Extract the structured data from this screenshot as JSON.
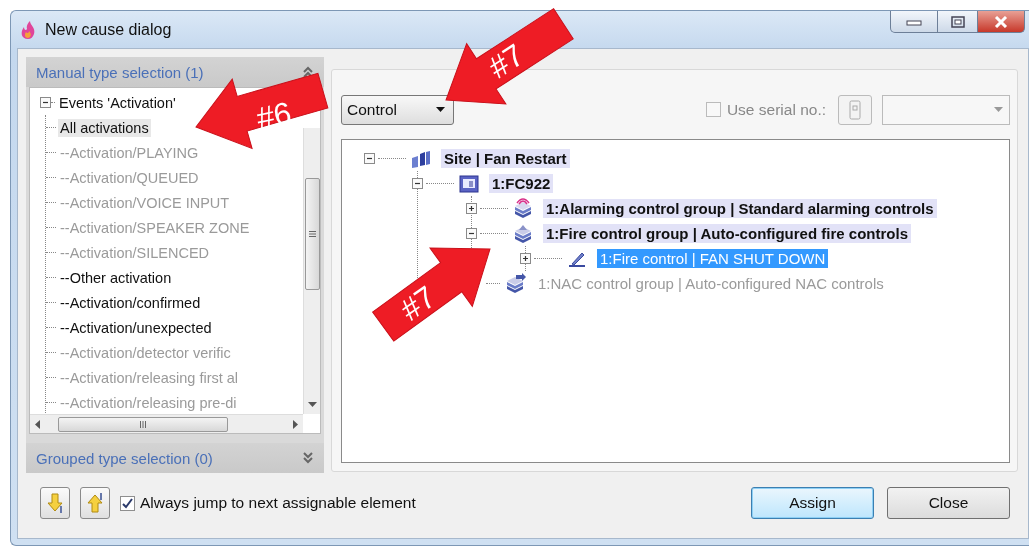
{
  "window": {
    "title": "New cause dialog"
  },
  "manual_panel": {
    "title": "Manual type selection (1)",
    "expanded": true,
    "tree": [
      {
        "label": "Events 'Activation'",
        "expanded": true,
        "children": [
          {
            "label": "All activations",
            "selected": true,
            "disabled": false
          },
          {
            "label": "--Activation/PLAYING",
            "selected": false,
            "disabled": true
          },
          {
            "label": "--Activation/QUEUED",
            "selected": false,
            "disabled": true
          },
          {
            "label": "--Activation/VOICE INPUT",
            "selected": false,
            "disabled": true
          },
          {
            "label": "--Activation/SPEAKER ZONE",
            "selected": false,
            "disabled": true
          },
          {
            "label": "--Activation/SILENCED",
            "selected": false,
            "disabled": true
          },
          {
            "label": "--Other activation",
            "selected": false,
            "disabled": false
          },
          {
            "label": "--Activation/confirmed",
            "selected": false,
            "disabled": false
          },
          {
            "label": "--Activation/unexpected",
            "selected": false,
            "disabled": false
          },
          {
            "label": "--Activation/detector verific",
            "selected": false,
            "disabled": true
          },
          {
            "label": "--Activation/releasing first al",
            "selected": false,
            "disabled": true
          },
          {
            "label": "--Activation/releasing pre-di",
            "selected": false,
            "disabled": true
          }
        ]
      }
    ]
  },
  "grouped_panel": {
    "title": "Grouped type selection (0)",
    "expanded": false
  },
  "type_combo": {
    "value": "Control"
  },
  "serial": {
    "label": "Use serial no.:",
    "checked": false,
    "disabled": true
  },
  "element_tree": [
    {
      "kind": "site",
      "label": "Site | Fan Restart",
      "expanded": true,
      "selected": false,
      "disabled": false,
      "children": [
        {
          "kind": "panel",
          "label": "1:FC922",
          "expanded": true,
          "selected": false,
          "disabled": false,
          "children": [
            {
              "kind": "alarm-group",
              "label": "1:Alarming control group | Standard alarming controls",
              "expanded": false,
              "selected": false,
              "disabled": false
            },
            {
              "kind": "fire-group",
              "label": "1:Fire control group | Auto-configured fire controls",
              "expanded": true,
              "selected": false,
              "disabled": false,
              "children": [
                {
                  "kind": "control",
                  "label": "1:Fire control | FAN SHUT DOWN",
                  "expanded": false,
                  "selected": true,
                  "disabled": false
                }
              ]
            },
            {
              "kind": "nac-group",
              "label": "1:NAC control group | Auto-configured NAC controls",
              "selected": false,
              "disabled": true
            }
          ]
        }
      ]
    }
  ],
  "always_jump": {
    "label": "Always jump to next assignable element",
    "checked": true
  },
  "buttons": [
    {
      "label": "Assign",
      "default": true
    },
    {
      "label": "Close",
      "default": false
    }
  ],
  "callouts": [
    {
      "label": "#6"
    },
    {
      "label": "#7"
    },
    {
      "label": "#7"
    }
  ]
}
